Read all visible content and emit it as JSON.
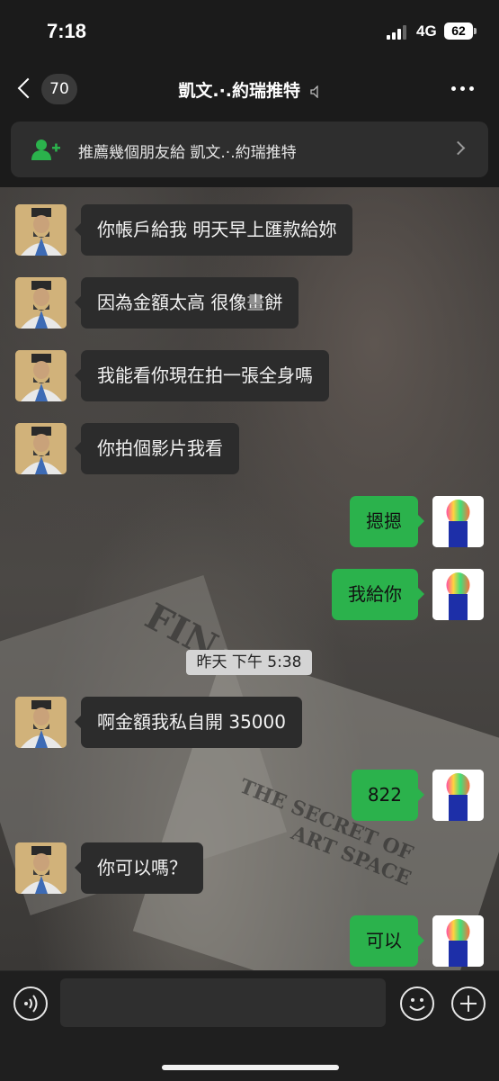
{
  "status_bar": {
    "time": "7:18",
    "network": "4G",
    "battery": "62"
  },
  "nav": {
    "unread_count": "70",
    "title": "凱文.·.約瑞推特",
    "back_icon": "chevron-left-icon",
    "mute_icon": "mute-icon",
    "more_icon": "more-dots-icon"
  },
  "banner": {
    "text": "推薦幾個朋友給 凱文.·.約瑞推特",
    "icon": "add-friend-icon",
    "accent_color": "#2bb24c"
  },
  "messages": [
    {
      "side": "in",
      "text": "你帳戶給我 明天早上匯款給妳"
    },
    {
      "side": "in",
      "text": "因為金額太高 很像畫餅"
    },
    {
      "side": "in",
      "text": "我能看你現在拍一張全身嗎"
    },
    {
      "side": "in",
      "text": "你拍個影片我看"
    },
    {
      "side": "out",
      "text": "摁摁"
    },
    {
      "side": "out",
      "text": "我給你"
    },
    {
      "side": "in",
      "text": "啊金額我私自開 35000"
    },
    {
      "side": "out",
      "text": "822"
    },
    {
      "side": "in",
      "text": "你可以嗎？"
    },
    {
      "side": "out",
      "text": "可以"
    }
  ],
  "timestamp": "昨天 下午 5:38",
  "colors": {
    "outgoing_bubble": "#2bb24c",
    "incoming_bubble": "#2c2c2c"
  },
  "input_bar": {
    "placeholder": "",
    "voice_icon": "voice-icon",
    "emoji_icon": "emoji-icon",
    "plus_icon": "plus-icon"
  }
}
